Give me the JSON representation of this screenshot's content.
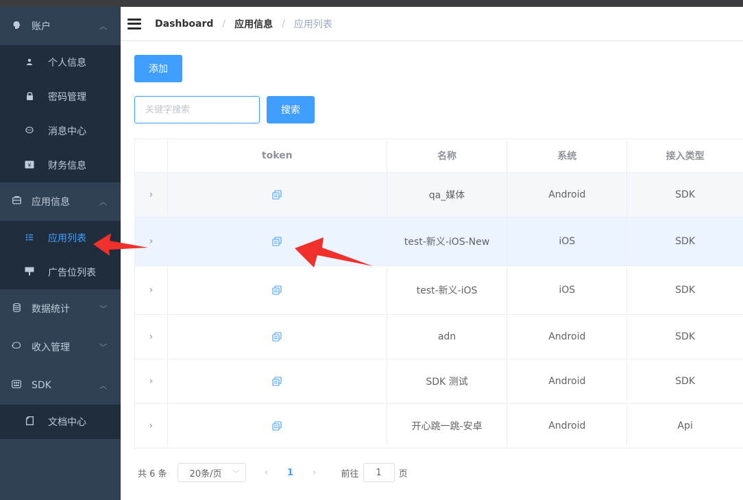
{
  "sidebar": {
    "groups": [
      {
        "label": "账户",
        "icon": "brain-icon",
        "expanded": true,
        "items": [
          {
            "label": "个人信息",
            "icon": "user-icon"
          },
          {
            "label": "密码管理",
            "icon": "lock-icon"
          },
          {
            "label": "消息中心",
            "icon": "chat-icon"
          },
          {
            "label": "财务信息",
            "icon": "yen-wallet-icon"
          }
        ]
      },
      {
        "label": "应用信息",
        "icon": "app-icon",
        "expanded": true,
        "items": [
          {
            "label": "应用列表",
            "icon": "list-icon",
            "active": true
          },
          {
            "label": "广告位列表",
            "icon": "billboard-icon"
          }
        ]
      },
      {
        "label": "数据统计",
        "icon": "database-icon",
        "expanded": false,
        "items": []
      },
      {
        "label": "收入管理",
        "icon": "piggy-bank-icon",
        "expanded": false,
        "items": []
      },
      {
        "label": "SDK",
        "icon": "sdk-icon",
        "expanded": true,
        "items": [
          {
            "label": "文档中心",
            "icon": "document-icon"
          }
        ]
      }
    ]
  },
  "header": {
    "breadcrumb": [
      "Dashboard",
      "应用信息",
      "应用列表"
    ]
  },
  "toolbar": {
    "add_label": "添加",
    "search_placeholder": "关键字搜索",
    "search_label": "搜索"
  },
  "table": {
    "columns": [
      "",
      "token",
      "名称",
      "系统",
      "接入类型"
    ],
    "rows": [
      {
        "name": "qa_媒体",
        "system": "Android",
        "type": "SDK"
      },
      {
        "name": "test-新义-iOS-New",
        "system": "iOS",
        "type": "SDK"
      },
      {
        "name": "test-新义-iOS",
        "system": "iOS",
        "type": "SDK"
      },
      {
        "name": "adn",
        "system": "Android",
        "type": "SDK"
      },
      {
        "name": "SDK 测试",
        "system": "Android",
        "type": "SDK"
      },
      {
        "name": "开心跳一跳-安卓",
        "system": "Android",
        "type": "Api"
      }
    ]
  },
  "pagination": {
    "total_text": "共 6 条",
    "page_size": "20条/页",
    "current_page": "1",
    "goto_prefix": "前往",
    "goto_value": "1",
    "goto_suffix": "页"
  },
  "colors": {
    "sidebar_bg": "#304156",
    "submenu_bg": "#1f2d3d",
    "primary": "#409eff",
    "annotation_arrow": "#f0302a"
  }
}
